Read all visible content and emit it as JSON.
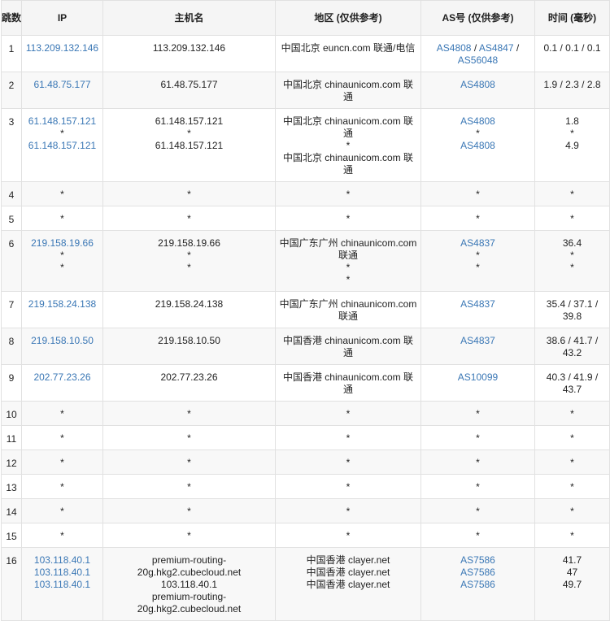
{
  "headers": {
    "hop": "跳数",
    "ip": "IP",
    "host": "主机名",
    "region": "地区 (仅供参考)",
    "as": "AS号 (仅供参考)",
    "time": "时间 (毫秒)"
  },
  "rows": [
    {
      "hop": "1",
      "ip": [
        "113.209.132.146"
      ],
      "host": [
        "113.209.132.146"
      ],
      "region": [
        "中国北京 euncn.com 联通/电信"
      ],
      "as": [
        [
          "AS4808",
          " / ",
          "AS4847",
          " /"
        ],
        [
          "AS56048"
        ]
      ],
      "time": [
        "0.1 / 0.1 / 0.1"
      ]
    },
    {
      "hop": "2",
      "ip": [
        "61.48.75.177"
      ],
      "host": [
        "61.48.75.177"
      ],
      "region": [
        "中国北京 chinaunicom.com 联通"
      ],
      "as": [
        [
          "AS4808"
        ]
      ],
      "time": [
        "1.9 / 2.3 / 2.8"
      ]
    },
    {
      "hop": "3",
      "ip": [
        "61.148.157.121",
        "*",
        "61.148.157.121"
      ],
      "host": [
        "61.148.157.121",
        "*",
        "61.148.157.121"
      ],
      "region": [
        "中国北京 chinaunicom.com 联通",
        "*",
        "中国北京 chinaunicom.com 联通"
      ],
      "as": [
        [
          "AS4808"
        ],
        [
          "*"
        ],
        [
          "AS4808"
        ]
      ],
      "time": [
        "1.8",
        "*",
        "4.9"
      ]
    },
    {
      "hop": "4",
      "ip": [
        "*"
      ],
      "host": [
        "*"
      ],
      "region": [
        "*"
      ],
      "as": [
        [
          "*"
        ]
      ],
      "time": [
        "*"
      ]
    },
    {
      "hop": "5",
      "ip": [
        "*"
      ],
      "host": [
        "*"
      ],
      "region": [
        "*"
      ],
      "as": [
        [
          "*"
        ]
      ],
      "time": [
        "*"
      ]
    },
    {
      "hop": "6",
      "ip": [
        "219.158.19.66",
        "*",
        "*"
      ],
      "host": [
        "219.158.19.66",
        "*",
        "*"
      ],
      "region": [
        "中国广东广州 chinaunicom.com",
        "联通",
        "*",
        "*"
      ],
      "as": [
        [
          "AS4837"
        ],
        [
          "*"
        ],
        [
          "*"
        ]
      ],
      "time": [
        "36.4",
        "*",
        "*"
      ]
    },
    {
      "hop": "7",
      "ip": [
        "219.158.24.138"
      ],
      "host": [
        "219.158.24.138"
      ],
      "region": [
        "中国广东广州 chinaunicom.com",
        "联通"
      ],
      "as": [
        [
          "AS4837"
        ]
      ],
      "time": [
        "35.4 / 37.1 /",
        "39.8"
      ]
    },
    {
      "hop": "8",
      "ip": [
        "219.158.10.50"
      ],
      "host": [
        "219.158.10.50"
      ],
      "region": [
        "中国香港 chinaunicom.com 联通"
      ],
      "as": [
        [
          "AS4837"
        ]
      ],
      "time": [
        "38.6 / 41.7 /",
        "43.2"
      ]
    },
    {
      "hop": "9",
      "ip": [
        "202.77.23.26"
      ],
      "host": [
        "202.77.23.26"
      ],
      "region": [
        "中国香港 chinaunicom.com 联通"
      ],
      "as": [
        [
          "AS10099"
        ]
      ],
      "time": [
        "40.3 / 41.9 /",
        "43.7"
      ]
    },
    {
      "hop": "10",
      "ip": [
        "*"
      ],
      "host": [
        "*"
      ],
      "region": [
        "*"
      ],
      "as": [
        [
          "*"
        ]
      ],
      "time": [
        "*"
      ]
    },
    {
      "hop": "11",
      "ip": [
        "*"
      ],
      "host": [
        "*"
      ],
      "region": [
        "*"
      ],
      "as": [
        [
          "*"
        ]
      ],
      "time": [
        "*"
      ]
    },
    {
      "hop": "12",
      "ip": [
        "*"
      ],
      "host": [
        "*"
      ],
      "region": [
        "*"
      ],
      "as": [
        [
          "*"
        ]
      ],
      "time": [
        "*"
      ]
    },
    {
      "hop": "13",
      "ip": [
        "*"
      ],
      "host": [
        "*"
      ],
      "region": [
        "*"
      ],
      "as": [
        [
          "*"
        ]
      ],
      "time": [
        "*"
      ]
    },
    {
      "hop": "14",
      "ip": [
        "*"
      ],
      "host": [
        "*"
      ],
      "region": [
        "*"
      ],
      "as": [
        [
          "*"
        ]
      ],
      "time": [
        "*"
      ]
    },
    {
      "hop": "15",
      "ip": [
        "*"
      ],
      "host": [
        "*"
      ],
      "region": [
        "*"
      ],
      "as": [
        [
          "*"
        ]
      ],
      "time": [
        "*"
      ]
    },
    {
      "hop": "16",
      "ip": [
        "103.118.40.1",
        "103.118.40.1",
        "103.118.40.1"
      ],
      "host": [
        "premium-routing-",
        "20g.hkg2.cubecloud.net",
        "103.118.40.1",
        "premium-routing-",
        "20g.hkg2.cubecloud.net"
      ],
      "region": [
        "中国香港 clayer.net",
        "中国香港 clayer.net",
        "中国香港 clayer.net"
      ],
      "as": [
        [
          "AS7586"
        ],
        [
          "AS7586"
        ],
        [
          "AS7586"
        ]
      ],
      "time": [
        "41.7",
        "47",
        "49.7"
      ]
    }
  ],
  "colors": {
    "link": "#3a77b5",
    "header_bg": "#f5f5f5",
    "stripe_bg": "#f8f8f8",
    "border": "#e1e1e1"
  }
}
